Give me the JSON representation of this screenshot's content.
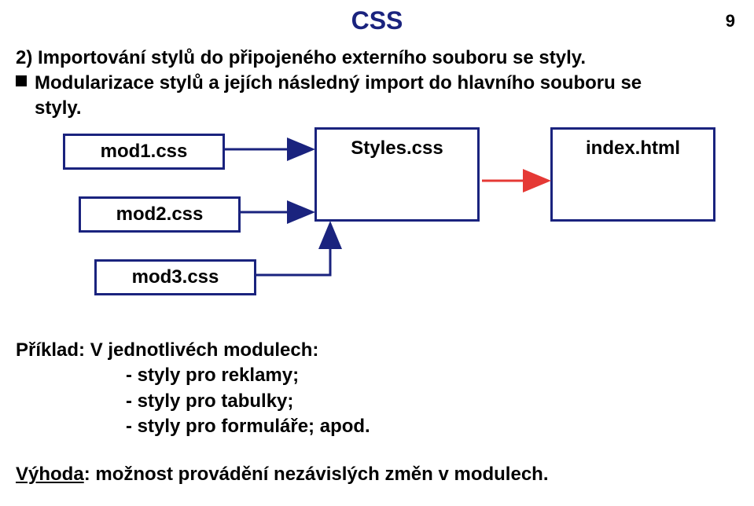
{
  "title": "CSS",
  "page_number": "9",
  "heading": "2) Importování stylů do připojeného externího souboru se styly.",
  "bullet_line1": "Modularizace stylů a jejích následný import do hlavního souboru se",
  "bullet_line2": "styly.",
  "diagram": {
    "mod1": "mod1.css",
    "mod2": "mod2.css",
    "mod3": "mod3.css",
    "styles": "Styles.css",
    "index": "index.html"
  },
  "example": {
    "title": "Příklad: V jednotlivéch modulech:",
    "items": [
      "- styly pro reklamy;",
      "- styly pro tabulky;",
      "- styly pro formuláře; apod."
    ]
  },
  "footer_label": "Výhoda",
  "footer_rest": ": možnost provádění nezávislých změn v modulech."
}
